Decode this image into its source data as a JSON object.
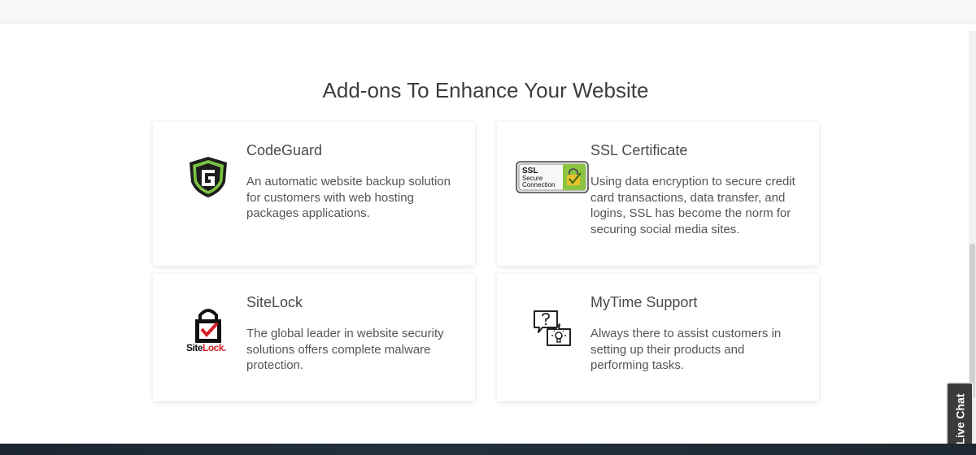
{
  "section": {
    "title": "Add-ons To Enhance Your Website"
  },
  "addons": [
    {
      "title": "CodeGuard",
      "description": "An automatic website backup solution for customers with web hosting packages applications.",
      "icon": "codeguard-logo-icon"
    },
    {
      "title": "SSL Certificate",
      "description": "Using data encryption to secure credit card transactions, data transfer, and logins, SSL has become the norm for securing social media sites.",
      "icon": "ssl-secure-connection-icon",
      "badge": {
        "line1": "SSL",
        "line2": "Secure",
        "line3": "Connection"
      }
    },
    {
      "title": "SiteLock",
      "description": "The global leader in website security solutions offers complete malware protection.",
      "icon": "sitelock-logo-icon",
      "logo_text": {
        "part1": "Site",
        "part2": "Lock",
        "suffix": "."
      }
    },
    {
      "title": "MyTime Support",
      "description": "Always there to assist customers in setting up their products and performing tasks.",
      "icon": "support-chat-bubbles-icon"
    }
  ],
  "live_chat": {
    "label": "Live Chat"
  },
  "colors": {
    "codeguard_green": "#7cc242",
    "codeguard_dark": "#1d1d1d",
    "ssl_green": "#8bc53f",
    "ssl_lock": "#e8c12b",
    "sitelock_red": "#d71f26",
    "text": "#555555",
    "title": "#3d3d3d"
  }
}
